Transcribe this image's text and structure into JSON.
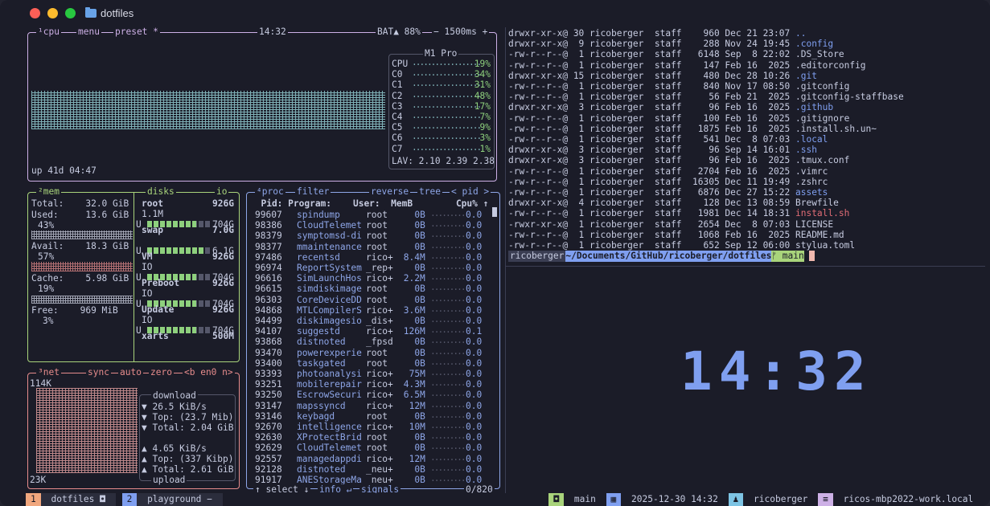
{
  "window": {
    "title": "dotfiles"
  },
  "cpu": {
    "tabs": [
      "¹cpu",
      "menu",
      "preset *"
    ],
    "time": "14:32",
    "battery": "BAT▲ 88%",
    "interval": "− 1500ms +",
    "uptime": "up 41d 04:47",
    "model": "M1 Pro",
    "rows": [
      [
        "CPU",
        "19%"
      ],
      [
        "C0",
        "34%"
      ],
      [
        "C1",
        "31%"
      ],
      [
        "C2",
        "48%"
      ],
      [
        "C3",
        "17%"
      ],
      [
        "C4",
        "7%"
      ],
      [
        "C5",
        "9%"
      ],
      [
        "C6",
        "3%"
      ],
      [
        "C7",
        "1%"
      ]
    ],
    "lav": "LAV: 2.10 2.39 2.38"
  },
  "mem": {
    "tabs": [
      "²mem",
      "disks",
      "io"
    ],
    "total": "Total:    32.0 GiB",
    "used": "Used:     13.6 GiB",
    "used_pct": "43%",
    "avail": "Avail:    18.3 GiB",
    "avail_pct": "57%",
    "cache": "Cache:    5.98 GiB",
    "cache_pct": "19%",
    "free": "Free:    969 MiB",
    "free_pct": "3%",
    "disks": [
      {
        "name": "root",
        "size": "926G",
        "io": "1.1M",
        "used": "704G",
        "level": 0.76
      },
      {
        "name": "swap",
        "size": "7.0G",
        "io": "",
        "used": "6.1G",
        "level": 0.87
      },
      {
        "name": "VM",
        "size": "926G",
        "io": "IO",
        "used": "704G",
        "level": 0.76
      },
      {
        "name": "Preboot",
        "size": "926G",
        "io": "IO",
        "used": "704G",
        "level": 0.76
      },
      {
        "name": "Update",
        "size": "926G",
        "io": "IO",
        "used": "704G",
        "level": 0.76
      },
      {
        "name": "xarts",
        "size": "500M",
        "io": "",
        "used": "",
        "level": 0
      }
    ]
  },
  "net": {
    "tabs": [
      "³net",
      "sync",
      "auto",
      "zero",
      "<b en0 n>"
    ],
    "top": "114K",
    "bottom": "23K",
    "download": [
      "download",
      "▼ 26.5 KiB/s",
      "▼ Top: (23.7 Mib)",
      "▼ Total: 2.04 GiB"
    ],
    "upload": [
      "▲ 4.65 KiB/s",
      "▲ Top: (337 Kibp)",
      "▲ Total: 2.61 GiB",
      "upload"
    ]
  },
  "proc": {
    "tabs": [
      "⁴proc",
      "filter",
      "reverse",
      "tree",
      "< pid >"
    ],
    "header": "  Pid: Program:    User:  MemB        Cpu% ↑",
    "rows": [
      [
        "99607",
        "spindump",
        "root",
        "0B",
        "0.0"
      ],
      [
        "98386",
        "CloudTelemet",
        "root",
        "0B",
        "0.0"
      ],
      [
        "98379",
        "symptomsd-di",
        "root",
        "0B",
        "0.0"
      ],
      [
        "98377",
        "mmaintenance",
        "root",
        "0B",
        "0.0"
      ],
      [
        "97486",
        "recentsd",
        "rico+",
        "8.4M",
        "0.0"
      ],
      [
        "96974",
        "ReportSystem",
        "_rep+",
        "0B",
        "0.0"
      ],
      [
        "96616",
        "SimLaunchHos",
        "rico+",
        "2.2M",
        "0.0"
      ],
      [
        "96615",
        "simdiskimage",
        "root",
        "0B",
        "0.0"
      ],
      [
        "96303",
        "CoreDeviceDD",
        "root",
        "0B",
        "0.0"
      ],
      [
        "94868",
        "MTLCompilerS",
        "rico+",
        "3.6M",
        "0.0"
      ],
      [
        "94499",
        "diskimagesio",
        "_dis+",
        "0B",
        "0.0"
      ],
      [
        "94107",
        "suggestd",
        "rico+",
        "126M",
        "0.1"
      ],
      [
        "93868",
        "distnoted",
        "_fpsd",
        "0B",
        "0.0"
      ],
      [
        "93470",
        "powerexperie",
        "root",
        "0B",
        "0.0"
      ],
      [
        "93400",
        "taskgated",
        "root",
        "0B",
        "0.0"
      ],
      [
        "93393",
        "photoanalysi",
        "rico+",
        "75M",
        "0.0"
      ],
      [
        "93251",
        "mobilerepair",
        "rico+",
        "4.3M",
        "0.0"
      ],
      [
        "93250",
        "EscrowSecuri",
        "rico+",
        "6.5M",
        "0.0"
      ],
      [
        "93147",
        "mapssyncd",
        "rico+",
        "12M",
        "0.0"
      ],
      [
        "93146",
        "keybagd",
        "root",
        "0B",
        "0.0"
      ],
      [
        "92670",
        "intelligence",
        "rico+",
        "10M",
        "0.0"
      ],
      [
        "92630",
        "XProtectBrid",
        "root",
        "0B",
        "0.0"
      ],
      [
        "92629",
        "CloudTelemet",
        "root",
        "0B",
        "0.0"
      ],
      [
        "92557",
        "managedappdi",
        "rico+",
        "12M",
        "0.0"
      ],
      [
        "92128",
        "distnoted",
        "_neu+",
        "0B",
        "0.0"
      ],
      [
        "91917",
        "ANEStorageMa",
        "_neu+",
        "0B",
        "0.0"
      ]
    ],
    "footer_left": "↑ select ↓",
    "footer_info": "info ↵",
    "footer_signals": "signals",
    "footer_count": "0/820"
  },
  "ls": [
    [
      "drwxr-xr-x@ 30 ricoberger  staff    960 Dec 21 23:07 ",
      "..",
      "dir"
    ],
    [
      "drwxr-xr-x@  9 ricoberger  staff    288 Nov 24 19:45 ",
      ".config",
      "dir"
    ],
    [
      "-rw-r--r--@  1 ricoberger  staff   6148 Sep  8 22:02 ",
      ".DS_Store",
      "file"
    ],
    [
      "-rw-r--r--@  1 ricoberger  staff    147 Feb 16  2025 ",
      ".editorconfig",
      "file"
    ],
    [
      "drwxr-xr-x@ 15 ricoberger  staff    480 Dec 28 10:26 ",
      ".git",
      "dir"
    ],
    [
      "-rw-r--r--@  1 ricoberger  staff    840 Nov 17 08:50 ",
      ".gitconfig",
      "file"
    ],
    [
      "-rw-r--r--@  1 ricoberger  staff     56 Feb 21  2025 ",
      ".gitconfig-staffbase",
      "file"
    ],
    [
      "drwxr-xr-x@  3 ricoberger  staff     96 Feb 16  2025 ",
      ".github",
      "dir"
    ],
    [
      "-rw-r--r--@  1 ricoberger  staff    100 Feb 16  2025 ",
      ".gitignore",
      "file"
    ],
    [
      "-rw-r--r--@  1 ricoberger  staff   1875 Feb 16  2025 ",
      ".install.sh.un~",
      "file"
    ],
    [
      "-rw-r--r--@  1 ricoberger  staff    541 Dec  8 07:03 ",
      ".local",
      "dir"
    ],
    [
      "drwxr-xr-x@  3 ricoberger  staff     96 Sep 14 16:01 ",
      ".ssh",
      "dir"
    ],
    [
      "drwxr-xr-x@  3 ricoberger  staff     96 Feb 16  2025 ",
      ".tmux.conf",
      "file"
    ],
    [
      "-rw-r--r--@  1 ricoberger  staff   2704 Feb 16  2025 ",
      ".vimrc",
      "file"
    ],
    [
      "-rw-r--r--@  1 ricoberger  staff  16305 Dec 11 19:49 ",
      ".zshrc",
      "file"
    ],
    [
      "-rw-r--r--@  1 ricoberger  staff   6876 Dec 27 15:22 ",
      "assets",
      "dir"
    ],
    [
      "drwxr-xr-x@  4 ricoberger  staff    128 Dec 13 08:59 ",
      "Brewfile",
      "file"
    ],
    [
      "-rw-r--r--@  1 ricoberger  staff   1981 Dec 14 18:31 ",
      "install.sh",
      "exec"
    ],
    [
      "-rwxr-xr-x@  1 ricoberger  staff   2654 Dec  8 07:03 ",
      "LICENSE",
      "file"
    ],
    [
      "-rw-r--r--@  1 ricoberger  staff   1068 Feb 16  2025 ",
      "README.md",
      "file"
    ],
    [
      "-rw-r--r--@  1 ricoberger  staff    652 Sep 12 06:00 ",
      "stylua.toml",
      "file"
    ]
  ],
  "prompt": {
    "user": " ricoberger ",
    "path": " ~/Documents/GitHub/ricoberger/dotfiles ",
    "branch": " ᚠ main "
  },
  "clock": "14:32",
  "status": {
    "win1": "1",
    "win1_label": " dotfiles ◘ ",
    "win2": "2",
    "win2_label": " playground − ",
    "session": " main ",
    "date": " 2025-12-30 14:32 ",
    "user": " ricoberger ",
    "host": " ricos-mbp2022-work.local "
  },
  "colors": {
    "accent": "#8ea6e8",
    "green": "#a9d47b",
    "red": "#e78c8c",
    "purple": "#cdb0e6",
    "dir": "#7f9ff0",
    "exec": "#e06c75"
  }
}
